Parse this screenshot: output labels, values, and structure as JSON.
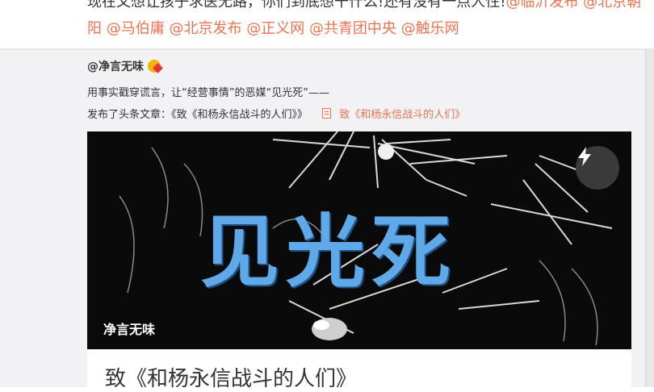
{
  "post": {
    "text": "现在又想让孩子求医无路，你们到底想干什么!还有没有一点人性!",
    "mentions": [
      "@临沂发布",
      "@北京朝阳",
      "@马伯庸",
      "@北京发布",
      "@正义网",
      "@共青团中央",
      "@触乐网"
    ]
  },
  "repost": {
    "author": "@净言无味",
    "line1": "用事实戳穿谎言，让“经营事情”的恶媒“见光死”——",
    "line2_prefix": "发布了头条文章：《致《和杨永信战斗的人们》》",
    "article_link": "致《和杨永信战斗的人们》"
  },
  "card": {
    "image_text": "见光死",
    "author": "净言无味",
    "title": "致《和杨永信战斗的人们》"
  },
  "colors": {
    "mention": "#eb7350",
    "image_title": "#5fa9e8"
  },
  "icons": [
    "emoji-heart-eyes-icon",
    "article-doc-icon",
    "lightning-icon"
  ]
}
